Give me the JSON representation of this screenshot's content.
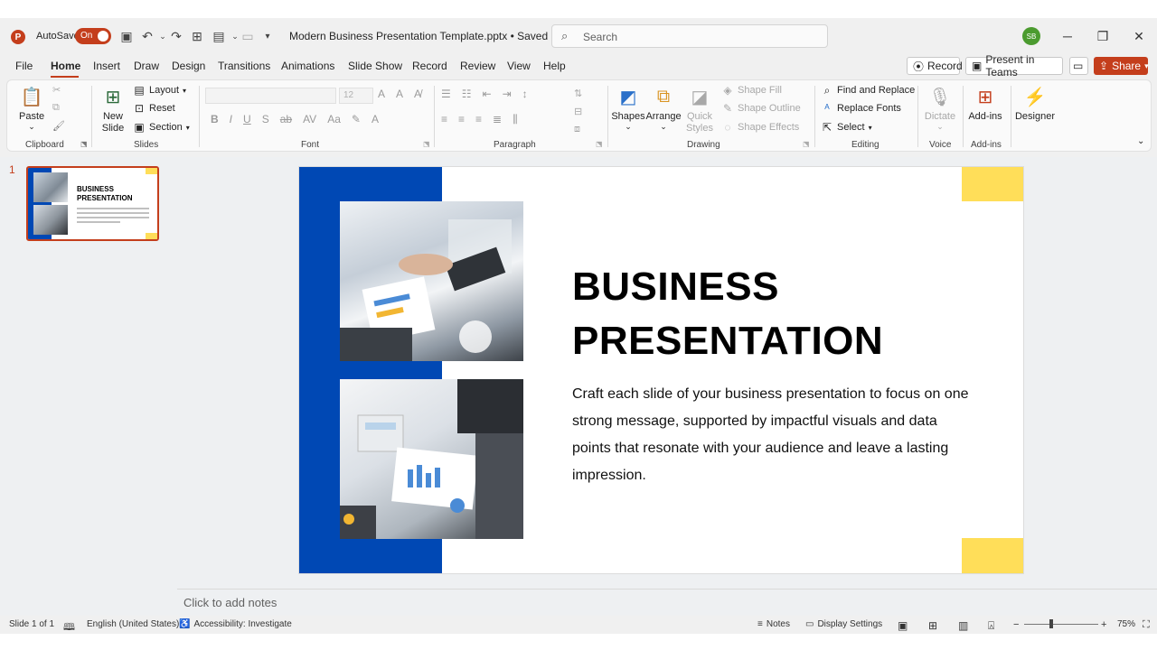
{
  "titlebar": {
    "autosave_label": "AutoSave",
    "autosave_state": "On",
    "doc_title": "Modern Business Presentation Template.pptx • Saved ∨",
    "search_placeholder": "Search",
    "user_initials": "SB"
  },
  "menu": {
    "tabs": [
      "File",
      "Home",
      "Insert",
      "Draw",
      "Design",
      "Transitions",
      "Animations",
      "Slide Show",
      "Record",
      "Review",
      "View",
      "Help"
    ],
    "record_label": "Record",
    "present_teams_label": "Present in Teams",
    "share_label": "Share"
  },
  "ribbon": {
    "clipboard": {
      "paste": "Paste",
      "label": "Clipboard"
    },
    "slides": {
      "new_slide": "New Slide",
      "layout": "Layout",
      "reset": "Reset",
      "section": "Section",
      "label": "Slides"
    },
    "font": {
      "size": "12",
      "label": "Font"
    },
    "paragraph": {
      "label": "Paragraph"
    },
    "drawing": {
      "shapes": "Shapes",
      "arrange": "Arrange",
      "quick_styles": "Quick Styles",
      "shape_fill": "Shape Fill",
      "shape_outline": "Shape Outline",
      "shape_effects": "Shape Effects",
      "label": "Drawing"
    },
    "editing": {
      "find_replace": "Find and Replace",
      "replace_fonts": "Replace Fonts",
      "select": "Select",
      "label": "Editing"
    },
    "voice": {
      "dictate": "Dictate",
      "label": "Voice"
    },
    "addins": {
      "addins": "Add-ins",
      "label": "Add-ins"
    },
    "designer": {
      "designer": "Designer"
    }
  },
  "thumbnail": {
    "number": "1",
    "title": "BUSINESS PRESENTATION"
  },
  "slide": {
    "title_line1": "BUSINESS",
    "title_line2": "PRESENTATION",
    "body": "Craft each slide of your business presentation to focus on one strong message, supported by impactful visuals and data points that resonate with your audience and leave a lasting impression.",
    "colors": {
      "blue": "#0048b4",
      "yellow": "#ffde59"
    }
  },
  "notes": {
    "placeholder": "Click to add notes"
  },
  "statusbar": {
    "slide_info": "Slide 1 of 1",
    "language": "English (United States)",
    "accessibility": "Accessibility: Investigate",
    "notes": "Notes",
    "display_settings": "Display Settings",
    "zoom": "75%"
  },
  "accent_color": "#c43e1c"
}
